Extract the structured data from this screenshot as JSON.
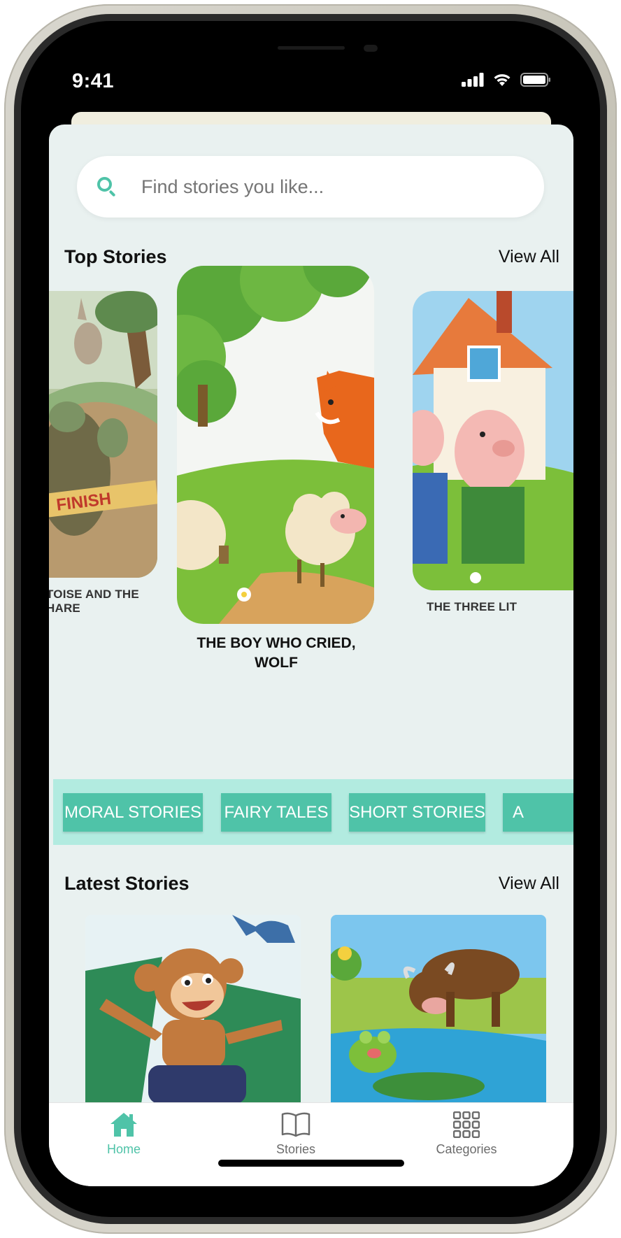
{
  "status_bar": {
    "time": "9:41"
  },
  "search": {
    "placeholder": "Find stories you like..."
  },
  "top_stories": {
    "title": "Top Stories",
    "view_all": "View All",
    "items": [
      {
        "label": "TOISE AND THE HARE"
      },
      {
        "label": "THE BOY WHO CRIED, WOLF"
      },
      {
        "label": "THE THREE LIT"
      }
    ],
    "finish_banner": "FINISH"
  },
  "categories": [
    {
      "label": "MORAL STORIES"
    },
    {
      "label": "FAIRY TALES"
    },
    {
      "label": "SHORT STORIES"
    },
    {
      "label": "A"
    }
  ],
  "latest_stories": {
    "title": "Latest Stories",
    "view_all": "View All"
  },
  "tabbar": {
    "home": "Home",
    "stories": "Stories",
    "categories": "Categories",
    "active": "home"
  },
  "colors": {
    "accent": "#4fc3a8",
    "category_strip": "#b2ebe0",
    "screen_bg": "#e9f1f0",
    "tab_inactive": "#6b6b6b"
  },
  "icons": [
    "search-icon",
    "home-icon",
    "book-icon",
    "grid-icon",
    "signal-icon",
    "wifi-icon",
    "battery-icon"
  ]
}
